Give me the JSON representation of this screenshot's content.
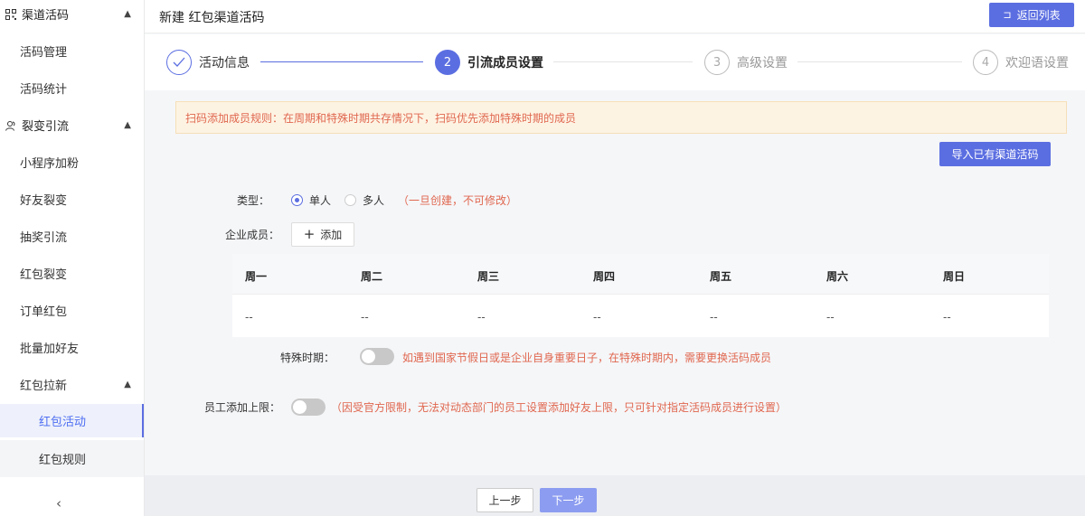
{
  "sidebar": {
    "groups": [
      {
        "label": "渠道活码",
        "icon": "qrcode-icon",
        "expanded": true
      },
      {
        "label": "裂变引流",
        "icon": "users-icon",
        "expanded": true
      }
    ],
    "items": [
      {
        "label": "活码管理"
      },
      {
        "label": "活码统计"
      },
      {
        "label": "小程序加粉"
      },
      {
        "label": "好友裂变"
      },
      {
        "label": "抽奖引流"
      },
      {
        "label": "红包裂变"
      },
      {
        "label": "订单红包"
      },
      {
        "label": "批量加好友"
      },
      {
        "label": "红包拉新"
      }
    ],
    "sub_items": [
      {
        "label": "红包活动",
        "active": true
      },
      {
        "label": "红包规则",
        "active": false
      }
    ],
    "collapse_icon": "chevron-left-icon"
  },
  "header": {
    "title": "新建 红包渠道活码",
    "back_label": "返回列表"
  },
  "steps": [
    {
      "number": "✓",
      "label": "活动信息",
      "state": "done"
    },
    {
      "number": "2",
      "label": "引流成员设置",
      "state": "current"
    },
    {
      "number": "3",
      "label": "高级设置",
      "state": "pending"
    },
    {
      "number": "4",
      "label": "欢迎语设置",
      "state": "pending"
    }
  ],
  "notice": "扫码添加成员规则：在周期和特殊时期共存情况下，扫码优先添加特殊时期的成员",
  "import_button": "导入已有渠道活码",
  "form": {
    "type_label": "类型：",
    "type_options": [
      "单人",
      "多人"
    ],
    "type_selected": "单人",
    "type_hint": "（一旦创建，不可修改）",
    "member_label": "企业成员：",
    "add_label": "添加",
    "special_label": "特殊时期：",
    "special_enabled": false,
    "special_hint": "如遇到国家节假日或是企业自身重要日子，在特殊时期内，需要更换活码成员",
    "limit_label": "员工添加上限：",
    "limit_enabled": false,
    "limit_hint": "（因受官方限制，无法对动态部门的员工设置添加好友上限，只可针对指定活码成员进行设置）"
  },
  "table": {
    "headers": [
      "周一",
      "周二",
      "周三",
      "周四",
      "周五",
      "周六",
      "周日"
    ],
    "row": [
      "--",
      "--",
      "--",
      "--",
      "--",
      "--",
      "--"
    ]
  },
  "footer": {
    "prev_label": "上一步",
    "next_label": "下一步"
  },
  "colors": {
    "accent": "#5b6ee1",
    "warning_text": "#e0674f",
    "notice_bg": "#fdf3e3"
  }
}
